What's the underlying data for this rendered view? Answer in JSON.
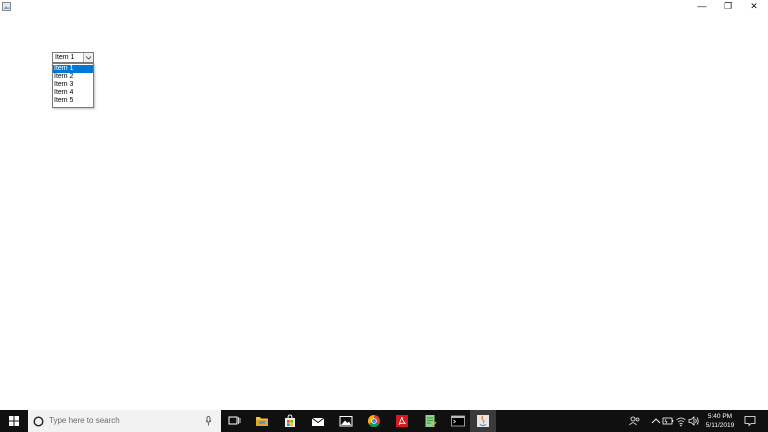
{
  "combo": {
    "selected": "Item 1",
    "items": [
      "Item 1",
      "Item 2",
      "Item 3",
      "Item 4",
      "Item 5"
    ]
  },
  "window": {
    "min_glyph": "—",
    "max_glyph": "❐",
    "close_glyph": "✕"
  },
  "taskbar": {
    "search_placeholder": "Type here to search",
    "time": "5:40 PM",
    "date": "5/11/2019"
  },
  "colors": {
    "selection": "#0078d7",
    "taskbar_bg": "#101010"
  },
  "icons": [
    "app-icon",
    "windows-logo-icon",
    "cortana-circle-icon",
    "microphone-icon",
    "task-view-icon",
    "file-explorer-icon",
    "store-icon",
    "mail-icon",
    "photos-icon",
    "chrome-icon",
    "acrobat-icon",
    "notepad-icon",
    "terminal-icon",
    "java-icon",
    "people-icon",
    "chevron-up-icon",
    "battery-icon",
    "wifi-icon",
    "volume-icon",
    "notification-icon"
  ]
}
